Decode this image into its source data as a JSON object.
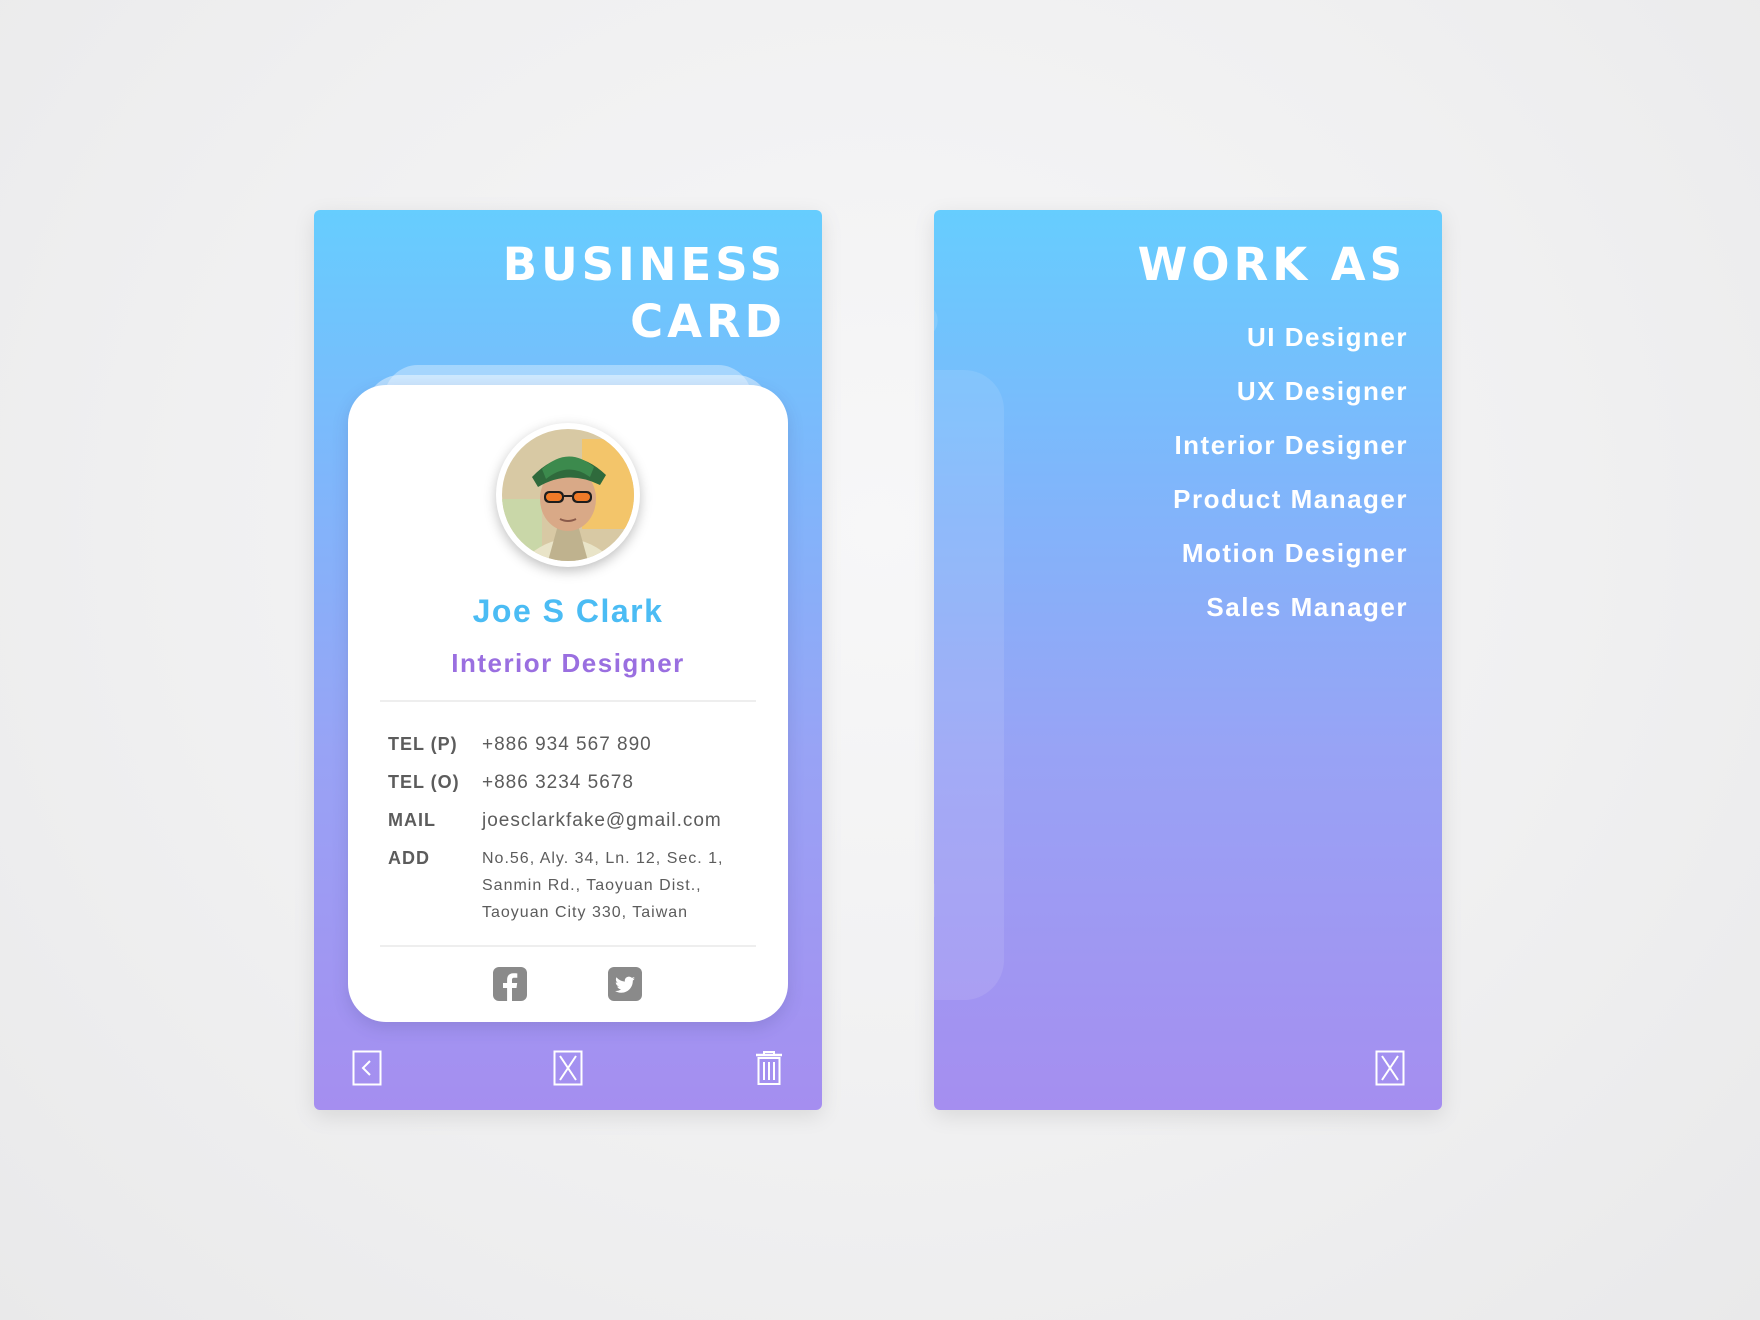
{
  "left_screen": {
    "title_lines": [
      "BUSINESS",
      "CARD"
    ],
    "card": {
      "name": "Joe S Clark",
      "role": "Interior Designer",
      "contacts": [
        {
          "label": "TEL (P)",
          "value": "+886 934 567 890"
        },
        {
          "label": "TEL (O)",
          "value": "+886 3234 5678"
        },
        {
          "label": "MAIL",
          "value": "joesclarkfake@gmail.com"
        },
        {
          "label": "ADD",
          "value": "No.56, Aly. 34, Ln. 12, Sec. 1, Sanmin Rd., Taoyuan Dist., Taoyuan City 330, Taiwan"
        }
      ],
      "social_icons": [
        "facebook-icon",
        "twitter-icon"
      ]
    },
    "toolbar_icons": [
      "back-icon",
      "close-icon",
      "trash-icon"
    ]
  },
  "right_screen": {
    "title": "WORK AS",
    "jobs": [
      "UI Designer",
      "UX Designer",
      "Interior Designer",
      "Product Manager",
      "Motion Designer",
      "Sales Manager"
    ],
    "toolbar_icons": [
      "close-icon"
    ]
  },
  "colors": {
    "gradient_top": "#66cdfe",
    "gradient_bottom": "#a58ef0",
    "name": "#4bbcf4",
    "role": "#9a6fe0",
    "text": "#5c5c5c"
  }
}
